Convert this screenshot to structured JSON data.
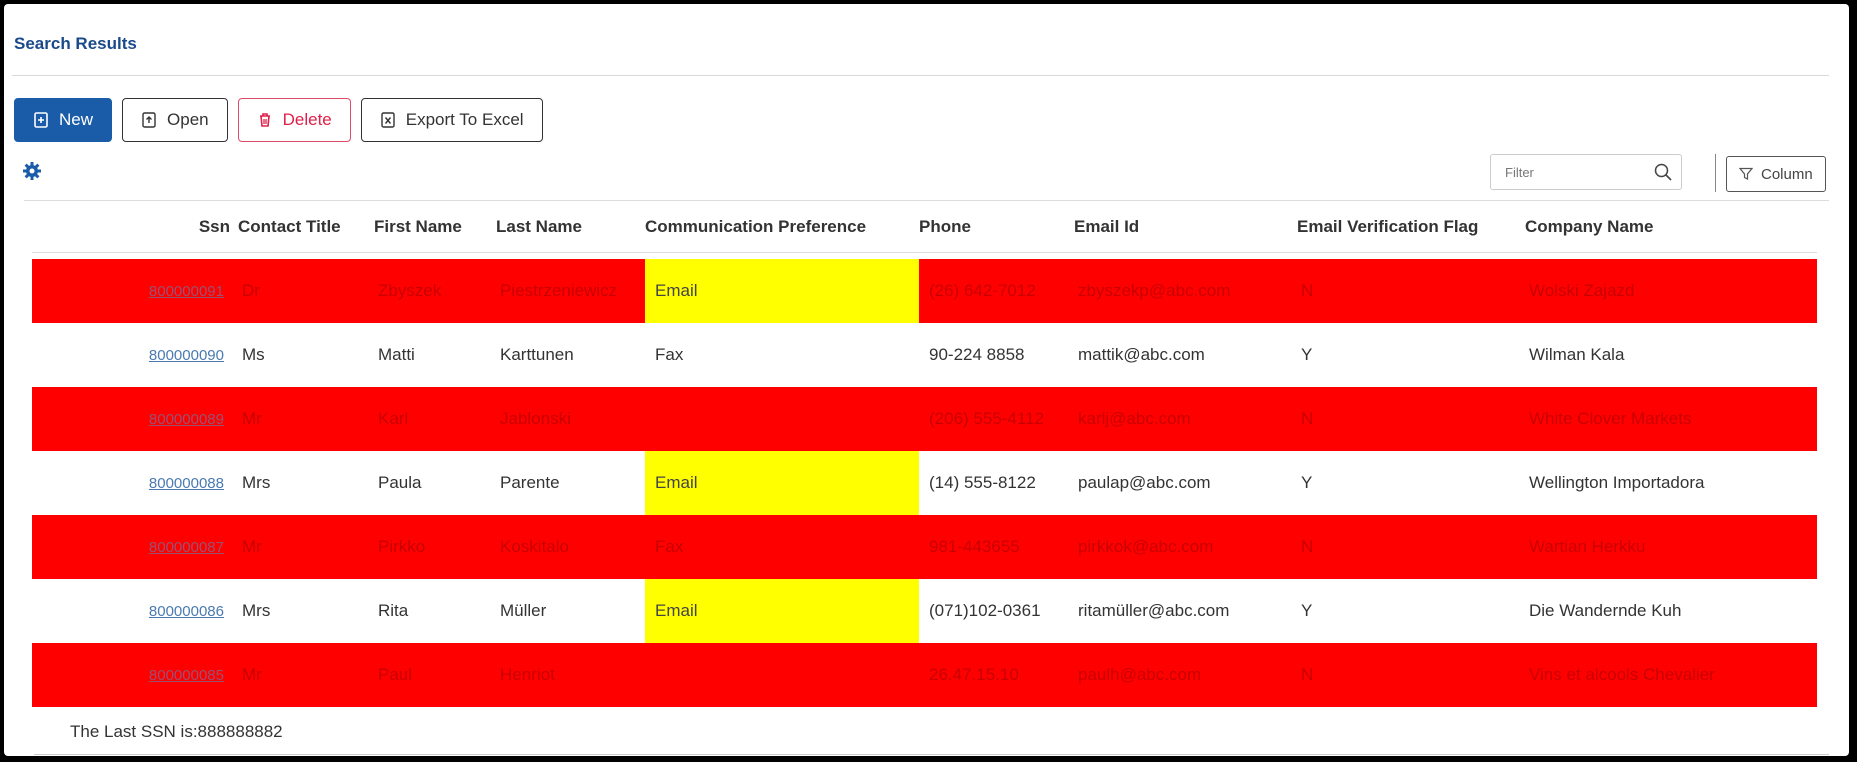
{
  "header": {
    "title": "Search Results"
  },
  "toolbar": {
    "new_label": "New",
    "open_label": "Open",
    "delete_label": "Delete",
    "export_label": "Export To Excel"
  },
  "filter": {
    "placeholder": "Filter",
    "column_label": "Column"
  },
  "table": {
    "columns": [
      "Ssn",
      "Contact Title",
      "First Name",
      "Last Name",
      "Communication Preference",
      "Phone",
      "Email Id",
      "Email Verification Flag",
      "Company Name"
    ],
    "rows": [
      {
        "ssn": "800000091",
        "title": "Dr",
        "first": "Zbyszek",
        "last": "Piestrzeniewicz",
        "pref": "Email",
        "phone": "(26) 642-7012",
        "email": "zbyszekp@abc.com",
        "flag": "N",
        "company": "Wolski  Zajazd",
        "style": "red",
        "pref_highlight": true
      },
      {
        "ssn": "800000090",
        "title": "Ms",
        "first": "Matti",
        "last": "Karttunen",
        "pref": "Fax",
        "phone": "90-224 8858",
        "email": "mattik@abc.com",
        "flag": "Y",
        "company": "Wilman Kala",
        "style": "white",
        "pref_highlight": false
      },
      {
        "ssn": "800000089",
        "title": "Mr",
        "first": "Karl",
        "last": "Jablonski",
        "pref": "",
        "phone": "(206) 555-4112",
        "email": "karlj@abc.com",
        "flag": "N",
        "company": "White Clover Markets",
        "style": "red",
        "pref_highlight": false
      },
      {
        "ssn": "800000088",
        "title": "Mrs",
        "first": "Paula",
        "last": "Parente",
        "pref": "Email",
        "phone": "(14) 555-8122",
        "email": "paulap@abc.com",
        "flag": "Y",
        "company": "Wellington Importadora",
        "style": "white",
        "pref_highlight": true
      },
      {
        "ssn": "800000087",
        "title": "Mr",
        "first": "Pirkko",
        "last": "Koskitalo",
        "pref": "Fax",
        "phone": "981-443655",
        "email": "pirkkok@abc.com",
        "flag": "N",
        "company": "Wartian Herkku",
        "style": "red",
        "pref_highlight": false
      },
      {
        "ssn": "800000086",
        "title": "Mrs",
        "first": "Rita",
        "last": "Müller",
        "pref": "Email",
        "phone": "(071)102-0361",
        "email": "ritamüller@abc.com",
        "flag": "Y",
        "company": "Die Wandernde Kuh",
        "style": "white",
        "pref_highlight": true
      },
      {
        "ssn": "800000085",
        "title": "Mr",
        "first": "Paul",
        "last": "Henriot",
        "pref": "",
        "phone": "26.47.15.10",
        "email": "paulh@abc.com",
        "flag": "N",
        "company": "Vins et alcools Chevalier",
        "style": "red",
        "pref_highlight": false
      }
    ]
  },
  "footer": {
    "text": "The Last SSN is:888888882"
  },
  "colors": {
    "accent": "#1a5ca8",
    "row_alert": "#ff0000",
    "highlight": "#ffff00",
    "delete": "#e0204a"
  }
}
